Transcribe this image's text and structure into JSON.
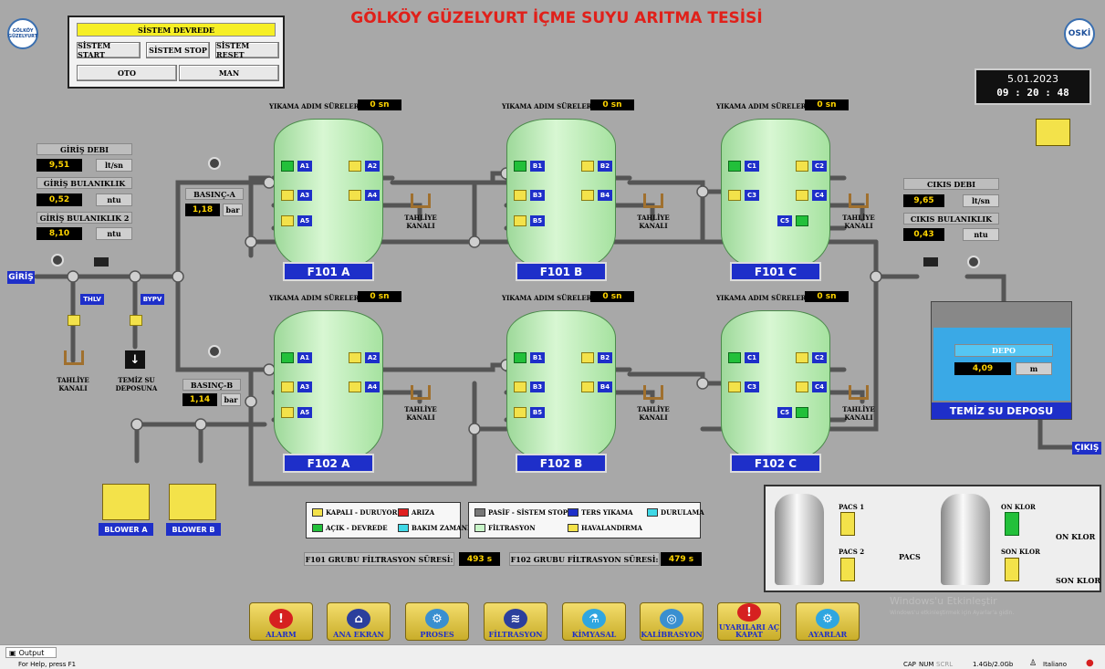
{
  "header": {
    "title": "GÖLKÖY GÜZELYURT İÇME SUYU ARITMA TESİSİ",
    "left_logo": "GÖLKÖY GÜZELYURT",
    "right_logo": "OSKİ"
  },
  "control": {
    "status": "SİSTEM DEVREDE",
    "start": "SİSTEM START",
    "stop": "SİSTEM STOP",
    "reset": "SİSTEM RESET",
    "oto": "OTO",
    "man": "MAN"
  },
  "clock": {
    "date": "5.01.2023",
    "time": "09 : 20 : 48"
  },
  "inlet": {
    "flow_label": "GİRİŞ DEBI",
    "flow_value": "9,51",
    "flow_unit": "lt/sn",
    "turb_label": "GİRİŞ BULANIKLIK",
    "turb_value": "0,52",
    "turb_unit": "ntu",
    "turb2_label": "GİRİŞ BULANIKLIK 2",
    "turb2_value": "8,10",
    "turb2_unit": "ntu",
    "tag": "GİRİŞ",
    "thlv": "THLV",
    "bypv": "BYPV",
    "tahliye": "TAHLİYE\nKANALI",
    "temiz": "TEMİZ SU\nDEPOSUNA"
  },
  "pressure": {
    "a_label": "BASINÇ-A",
    "a_value": "1,18",
    "b_label": "BASINÇ-B",
    "b_value": "1,14",
    "unit": "bar"
  },
  "wash_label": "YIKAMA ADIM SÜRELERİ:",
  "tahliye_label": "TAHLİYE\nKANALI",
  "filters": [
    {
      "name": "F101 A",
      "wash": "0 sn",
      "p": "A"
    },
    {
      "name": "F101 B",
      "wash": "0 sn",
      "p": "B"
    },
    {
      "name": "F101 C",
      "wash": "0 sn",
      "p": "C"
    },
    {
      "name": "F102 A",
      "wash": "0 sn",
      "p": "A"
    },
    {
      "name": "F102 B",
      "wash": "0 sn",
      "p": "B"
    },
    {
      "name": "F102 C",
      "wash": "0 sn",
      "p": "C"
    }
  ],
  "outlet": {
    "flow_label": "CIKIS DEBI",
    "flow_value": "9,65",
    "flow_unit": "lt/sn",
    "turb_label": "CIKIS BULANIKLIK",
    "turb_value": "0,43",
    "turb_unit": "ntu",
    "tag": "ÇIKIŞ"
  },
  "depot": {
    "label": "DEPO",
    "value": "4,09",
    "unit": "m",
    "name": "TEMİZ SU DEPOSU"
  },
  "blowers": [
    "BLOWER A",
    "BLOWER B"
  ],
  "legend1": [
    {
      "label": "KAPALI - DURUYOR",
      "color": "#f3e24a"
    },
    {
      "label": "ARIZA",
      "color": "#e02020"
    },
    {
      "label": "AÇIK - DEVREDE",
      "color": "#22c03a"
    },
    {
      "label": "BAKIM ZAMANI",
      "color": "#3fd8e6"
    }
  ],
  "legend2": [
    {
      "label": "PASİF - SİSTEM STOP",
      "color": "#777777"
    },
    {
      "label": "TERS YIKAMA",
      "color": "#1e2fc9"
    },
    {
      "label": "DURULAMA",
      "color": "#3fd8e6"
    },
    {
      "label": "FİLTRASYON",
      "color": "#c8f5c8"
    },
    {
      "label": "HAVALANDIRMA",
      "color": "#f3e24a"
    }
  ],
  "filtration": {
    "f101_label": "F101 GRUBU FİLTRASYON SÜRESİ:",
    "f101_value": "493 s",
    "f102_label": "F102 GRUBU FİLTRASYON SÜRESİ:",
    "f102_value": "479 s"
  },
  "chem": {
    "pacs1": "PACS 1",
    "pacs2": "PACS 2",
    "pacs": "PACS",
    "on_klor": "ON KLOR",
    "son_klor": "SON KLOR",
    "on_klor_out": "ON KLOR",
    "son_klor_out": "SON KLOR"
  },
  "nav": [
    {
      "label": "ALARM",
      "icon": "!",
      "color": "#d62020"
    },
    {
      "label": "ANA EKRAN",
      "icon": "⌂",
      "color": "#2b3f9c"
    },
    {
      "label": "PROSES",
      "icon": "⚙",
      "color": "#3a8fd0"
    },
    {
      "label": "FİLTRASYON",
      "icon": "≋",
      "color": "#2b3f9c"
    },
    {
      "label": "KİMYASAL",
      "icon": "⚗",
      "color": "#2fa6e0"
    },
    {
      "label": "KALİBRASYON",
      "icon": "◎",
      "color": "#3a8fd0"
    },
    {
      "label": "UYARILARI AÇ KAPAT",
      "icon": "!",
      "color": "#d62020"
    },
    {
      "label": "AYARLAR",
      "icon": "⚙",
      "color": "#2fa6e0"
    }
  ],
  "statusbar": {
    "tab": "Output",
    "help": "For Help, press F1",
    "cap": "CAP",
    "num": "NUM",
    "scrl": "SCRL",
    "net": "1.4Gb/2.0Gb",
    "lang": "Italiano"
  },
  "watermark": {
    "line1": "Windows'u Etkinleştir",
    "line2": "Windows'u etkinleştirmek için Ayarlar'a gidin."
  }
}
